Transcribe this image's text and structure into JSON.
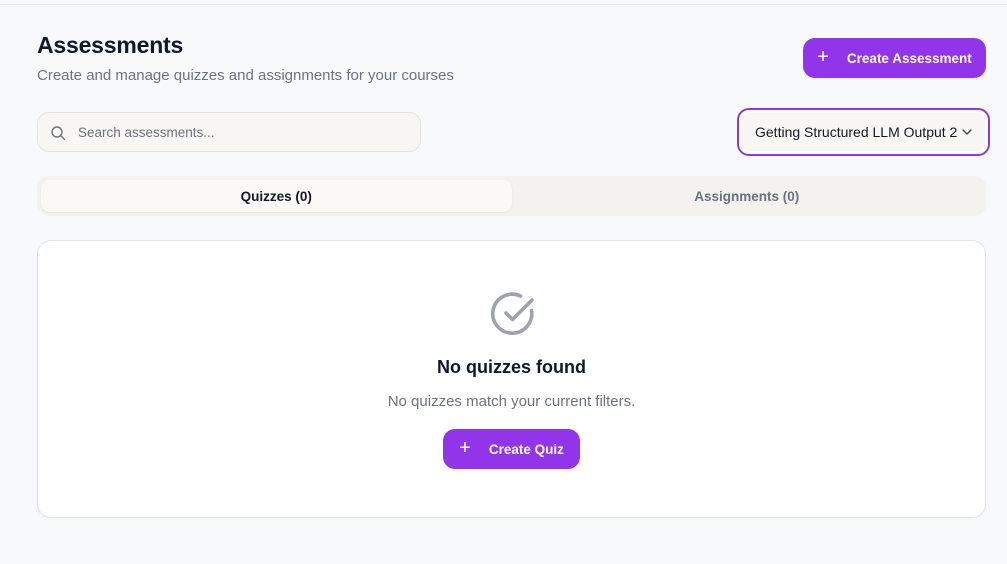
{
  "header": {
    "title": "Assessments",
    "subtitle": "Create and manage quizzes and assignments for your courses",
    "create_assessment_label": "Create Assessment"
  },
  "filters": {
    "search_placeholder": "Search assessments...",
    "search_value": "",
    "course_selected": "Getting Structured LLM Output 2"
  },
  "tabs": [
    {
      "label": "Quizzes (0)",
      "active": true
    },
    {
      "label": "Assignments (0)",
      "active": false
    }
  ],
  "empty_state": {
    "icon": "check-circle-icon",
    "title": "No quizzes found",
    "text": "No quizzes match your current filters.",
    "button_label": "Create Quiz"
  },
  "colors": {
    "accent": "#9234ea",
    "background": "#f8f9fb",
    "muted_text": "#6b7280"
  }
}
